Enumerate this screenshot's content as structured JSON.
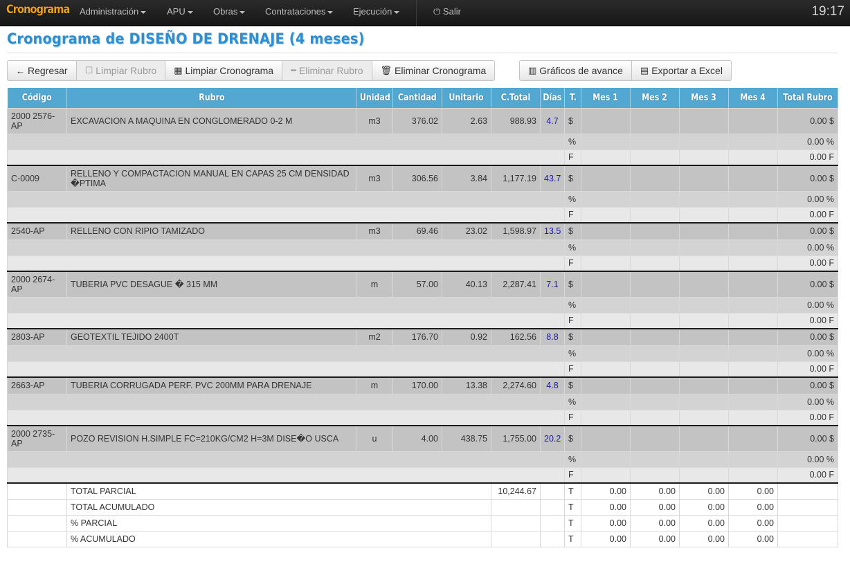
{
  "navbar": {
    "brand": "Cronograma",
    "menus": [
      {
        "label": "Administración",
        "has_caret": true
      },
      {
        "label": "APU",
        "has_caret": true
      },
      {
        "label": "Obras",
        "has_caret": true
      },
      {
        "label": "Contrataciones",
        "has_caret": true
      },
      {
        "label": "Ejecución",
        "has_caret": true
      }
    ],
    "logout_label": "Salir",
    "logout_icon": "power-icon",
    "clock": "19:17"
  },
  "page": {
    "title": "Cronograma de DISEÑO DE DRENAJE (4 meses)"
  },
  "toolbar": {
    "group1": [
      {
        "label": "Regresar",
        "icon": "←",
        "icon_name": "arrow-left-icon",
        "disabled": false
      },
      {
        "label": "Limpiar Rubro",
        "icon": "☐",
        "icon_name": "checkbox-icon",
        "disabled": true
      },
      {
        "label": "Limpiar Cronograma",
        "icon": "▦",
        "icon_name": "grid-icon",
        "disabled": false
      },
      {
        "label": "Eliminar Rubro",
        "icon": "━",
        "icon_name": "minus-icon",
        "disabled": true
      },
      {
        "label": "Eliminar Cronograma",
        "icon": "🗑",
        "icon_name": "trash-icon",
        "disabled": false
      }
    ],
    "group2": [
      {
        "label": "Gráficos de avance",
        "icon": "▥",
        "icon_name": "bar-chart-icon",
        "disabled": false
      },
      {
        "label": "Exportar a Excel",
        "icon": "▤",
        "icon_name": "table-icon",
        "disabled": false
      }
    ]
  },
  "table": {
    "headers": [
      "Código",
      "Rubro",
      "Unidad",
      "Cantidad",
      "Unitario",
      "C.Total",
      "Días",
      "T.",
      "Mes 1",
      "Mes 2",
      "Mes 3",
      "Mes 4",
      "Total Rubro"
    ],
    "rows": [
      {
        "code": "2000\n2576-AP",
        "rubro": "EXCAVACION A MAQUINA EN CONGLOMERADO 0-2 M",
        "unidad": "m3",
        "cantidad": "376.02",
        "unitario": "2.63",
        "ctotal": "988.93",
        "dias": "4.7",
        "tot_dollar": "0.00 $",
        "tot_pct": "0.00 %",
        "tot_f": "0.00 F",
        "tall": true
      },
      {
        "code": "C-0009",
        "rubro": "RELLENO Y COMPACTACION MANUAL EN CAPAS 25 CM DENSIDAD �PTIMA",
        "unidad": "m3",
        "cantidad": "306.56",
        "unitario": "3.84",
        "ctotal": "1,177.19",
        "dias": "43.7",
        "tot_dollar": "0.00 $",
        "tot_pct": "0.00 %",
        "tot_f": "0.00 F",
        "tall": true
      },
      {
        "code": "2540-AP",
        "rubro": "RELLENO CON RIPIO TAMIZADO",
        "unidad": "m3",
        "cantidad": "69.46",
        "unitario": "23.02",
        "ctotal": "1,598.97",
        "dias": "13.5",
        "tot_dollar": "0.00 $",
        "tot_pct": "0.00 %",
        "tot_f": "0.00 F",
        "tall": false
      },
      {
        "code": "2000\n2674-AP",
        "rubro": "TUBERIA PVC DESAGUE � 315 MM",
        "unidad": "m",
        "cantidad": "57.00",
        "unitario": "40.13",
        "ctotal": "2,287.41",
        "dias": "7.1",
        "tot_dollar": "0.00 $",
        "tot_pct": "0.00 %",
        "tot_f": "0.00 F",
        "tall": true
      },
      {
        "code": "2803-AP",
        "rubro": "GEOTEXTIL TEJIDO 2400T",
        "unidad": "m2",
        "cantidad": "176.70",
        "unitario": "0.92",
        "ctotal": "162.56",
        "dias": "8.8",
        "tot_dollar": "0.00 $",
        "tot_pct": "0.00 %",
        "tot_f": "0.00 F",
        "tall": false
      },
      {
        "code": "2663-AP",
        "rubro": "TUBERIA CORRUGADA PERF. PVC 200MM PARA DRENAJE",
        "unidad": "m",
        "cantidad": "170.00",
        "unitario": "13.38",
        "ctotal": "2,274.60",
        "dias": "4.8",
        "tot_dollar": "0.00 $",
        "tot_pct": "0.00 %",
        "tot_f": "0.00 F",
        "tall": false
      },
      {
        "code": "2000\n2735-AP",
        "rubro": "POZO REVISION H.SIMPLE FC=210KG/CM2 H=3M DISE�O USCA",
        "unidad": "u",
        "cantidad": "4.00",
        "unitario": "438.75",
        "ctotal": "1,755.00",
        "dias": "20.2",
        "tot_dollar": "0.00 $",
        "tot_pct": "0.00 %",
        "tot_f": "0.00 F",
        "tall": true
      }
    ],
    "type_labels": {
      "dollar": "$",
      "pct": "%",
      "f": "F"
    },
    "totals": [
      {
        "label": "TOTAL PARCIAL",
        "ctotal": "10,244.67",
        "t": "T",
        "months": [
          "0.00",
          "0.00",
          "0.00",
          "0.00"
        ]
      },
      {
        "label": "TOTAL ACUMULADO",
        "ctotal": "",
        "t": "T",
        "months": [
          "0.00",
          "0.00",
          "0.00",
          "0.00"
        ]
      },
      {
        "label": "% PARCIAL",
        "ctotal": "",
        "t": "T",
        "months": [
          "0.00",
          "0.00",
          "0.00",
          "0.00"
        ]
      },
      {
        "label": "% ACUMULADO",
        "ctotal": "",
        "t": "T",
        "months": [
          "0.00",
          "0.00",
          "0.00",
          "0.00"
        ]
      }
    ]
  }
}
